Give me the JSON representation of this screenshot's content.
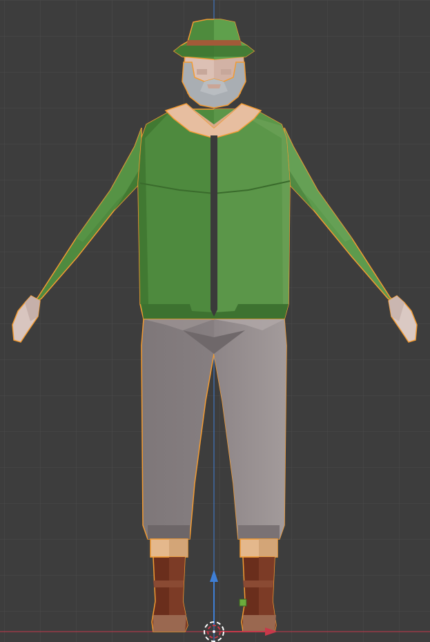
{
  "viewport": {
    "view": "front-orthographic",
    "background_color": "#3d3d3d",
    "grid_color": "#494949",
    "z_axis_color": "#3f7fd6",
    "x_axis_color": "#c8394a",
    "selection_outline_color": "#f39b32"
  },
  "scene": {
    "selected_object": "character-mesh",
    "character_parts": [
      "hat",
      "head",
      "beard",
      "jacket",
      "zipper",
      "arms",
      "hands",
      "trousers",
      "socks",
      "boots"
    ]
  },
  "gizmo": {
    "icons": [
      "origin-cursor-icon",
      "z-arrow-icon",
      "x-arrow-icon",
      "object-origin-icon"
    ]
  }
}
